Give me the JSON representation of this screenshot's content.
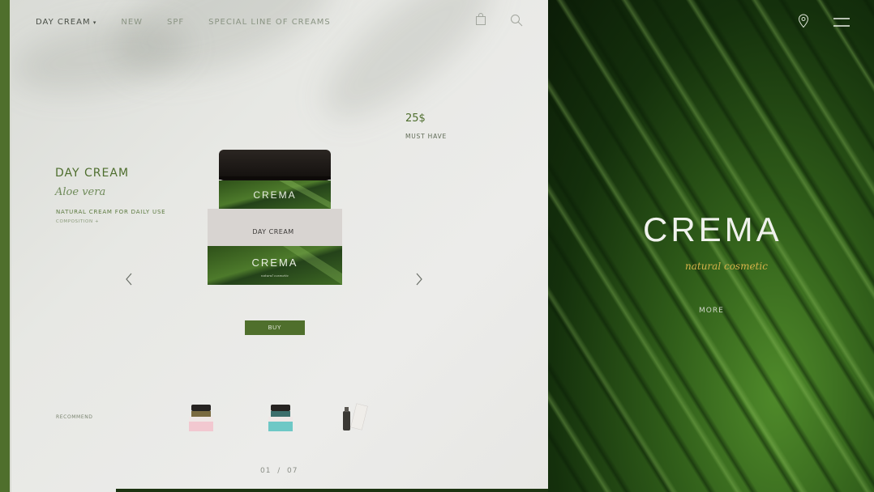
{
  "nav": {
    "items": [
      "DAY CREAM",
      "NEW",
      "SPF",
      "SPECIAL LINE OF CREAMS"
    ]
  },
  "icons": {
    "bag": "bag-icon",
    "search": "search-icon",
    "location": "location-pin-icon",
    "menu": "hamburger-menu-icon",
    "prev": "chevron-left-icon",
    "next": "chevron-right-icon"
  },
  "product": {
    "title": "DAY CREAM",
    "subtitle": "Aloe vera",
    "description": "NATURAL CREAM FOR DAILY USE",
    "composition": "COMPOSITION +",
    "price": "25$",
    "badge": "MUST HAVE",
    "jar_brand": "CREMA",
    "box_label": "DAY CREAM",
    "box_brand": "CREMA",
    "box_sub": "natural cosmetic"
  },
  "actions": {
    "buy_label": "BUY",
    "more_label": "MORE"
  },
  "recommend": {
    "label": "RECOMMEND"
  },
  "pager": {
    "current": "01",
    "separator": "/",
    "total": "07"
  },
  "hero": {
    "brand": "CREMA",
    "tagline": "natural cosmetic"
  },
  "colors": {
    "accent": "#4f6f2c",
    "gold": "#d6b24a"
  }
}
